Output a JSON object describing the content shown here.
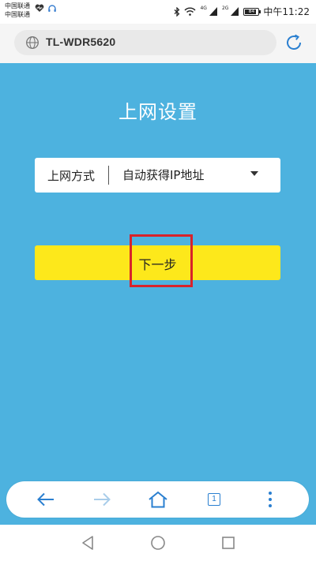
{
  "status_bar": {
    "carrier_1": "中国联通",
    "carrier_2": "中国联通",
    "signal_tag_1": "4G",
    "signal_tag_2": "2G",
    "battery_level": "84",
    "time": "中午11:22"
  },
  "address_bar": {
    "url": "TL-WDR5620"
  },
  "page": {
    "title": "上网设置",
    "connection_label": "上网方式",
    "connection_value": "自动获得IP地址",
    "next_label": "下一步"
  },
  "toolbar": {
    "tab_count": "1"
  },
  "colors": {
    "page_background": "#4db2df",
    "button": "#fde81b",
    "highlight": "#d8232a",
    "toolbar_icon": "#2a7fd0"
  }
}
